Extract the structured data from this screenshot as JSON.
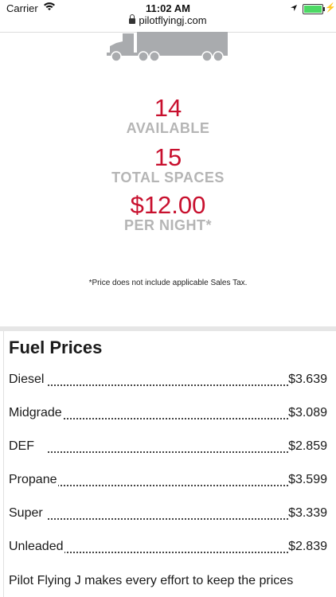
{
  "status_bar": {
    "carrier": "Carrier",
    "time": "11:02 AM"
  },
  "browser": {
    "url": "pilotflyingj.com"
  },
  "parking": {
    "available_count": "14",
    "available_label": "AVAILABLE",
    "total_count": "15",
    "total_label": "TOTAL SPACES",
    "price": "$12.00",
    "price_label": "PER NIGHT*",
    "tax_note": "*Price does not include applicable Sales Tax."
  },
  "fuel": {
    "title": "Fuel Prices",
    "items": [
      {
        "name": "Diesel",
        "price": "$3.639"
      },
      {
        "name": "Midgrade",
        "price": "$3.089"
      },
      {
        "name": "DEF",
        "price": "$2.859"
      },
      {
        "name": "Propane",
        "price": "$3.599"
      },
      {
        "name": "Super",
        "price": "$3.339"
      },
      {
        "name": "Unleaded",
        "price": "$2.839"
      }
    ],
    "disclaimer": "Pilot Flying J makes every effort to keep the prices"
  },
  "colors": {
    "accent_red": "#c8102e",
    "label_gray": "#b5b5b5",
    "battery_green": "#4cd964"
  }
}
